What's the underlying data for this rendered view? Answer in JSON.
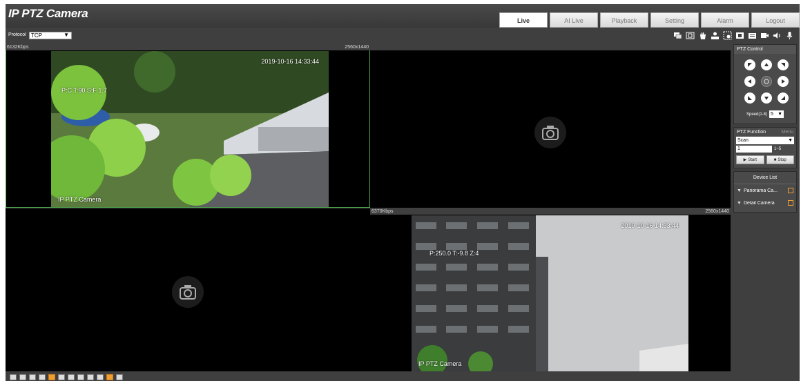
{
  "app": {
    "title": "IP PTZ Camera"
  },
  "tabs": [
    {
      "label": "Live",
      "active": true
    },
    {
      "label": "AI Live"
    },
    {
      "label": "Playback"
    },
    {
      "label": "Setting"
    },
    {
      "label": "Alarm"
    },
    {
      "label": "Logout"
    }
  ],
  "toolbar": {
    "protocol_label": "Protocol",
    "protocol_value": "TCP",
    "icons": [
      "window-switch-icon",
      "fullscreen-icon",
      "hand-icon",
      "person-icon",
      "zoom-icon",
      "snapshot-icon",
      "triple-snapshot-icon",
      "record-icon",
      "audio-icon",
      "microphone-icon"
    ]
  },
  "panes": [
    {
      "bitrate": "6132Kbps",
      "resolution": "2560x1440",
      "timestamp": "2019-10-16 14:33:44",
      "ptz_osd": "P:C T:90 S:F 1.7",
      "camera_name": "IP PTZ Camera",
      "has_video": true
    },
    {
      "has_video": false
    },
    {
      "has_video": false
    },
    {
      "bitrate": "6370Kbps",
      "resolution": "2560x1440",
      "timestamp": "2019-10-16 14:33:44",
      "ptz_osd": "P:250.0 T:-9.8 Z:4",
      "camera_name": "IP PTZ Camera",
      "has_video": true
    }
  ],
  "bottom_icons": [
    {
      "name": "original-scale-icon",
      "active": false
    },
    {
      "name": "fit-window-icon",
      "active": false
    },
    {
      "name": "zoom-in-icon",
      "active": false
    },
    {
      "name": "zoom-out-icon",
      "active": false
    },
    {
      "name": "layout-1-icon",
      "active": true
    },
    {
      "name": "layout-2-icon",
      "active": false
    },
    {
      "name": "layout-3-icon",
      "active": false
    },
    {
      "name": "layout-4-icon",
      "active": false
    },
    {
      "name": "layout-5-icon",
      "active": false
    },
    {
      "name": "layout-6-icon",
      "active": false
    },
    {
      "name": "layout-7-icon",
      "active": true
    },
    {
      "name": "layout-8-icon",
      "active": false
    }
  ],
  "ptz_control": {
    "title": "PTZ Control",
    "speed_label": "Speed(1-8)",
    "speed_value": "5"
  },
  "ptz_function": {
    "title": "PTZ Function",
    "menu_label": "Menu",
    "select_value": "Scan",
    "input_value": "1",
    "range": "1~5",
    "start_label": "Start",
    "stop_label": "Stop"
  },
  "device_list": {
    "title": "Device List",
    "items": [
      {
        "label": "Panorama Ca..."
      },
      {
        "label": "Detail Camera"
      }
    ]
  },
  "colors": {
    "frame_bg": "#3f3f3f",
    "select_green": "#4aa34a",
    "active_orange": "#f19e30"
  }
}
